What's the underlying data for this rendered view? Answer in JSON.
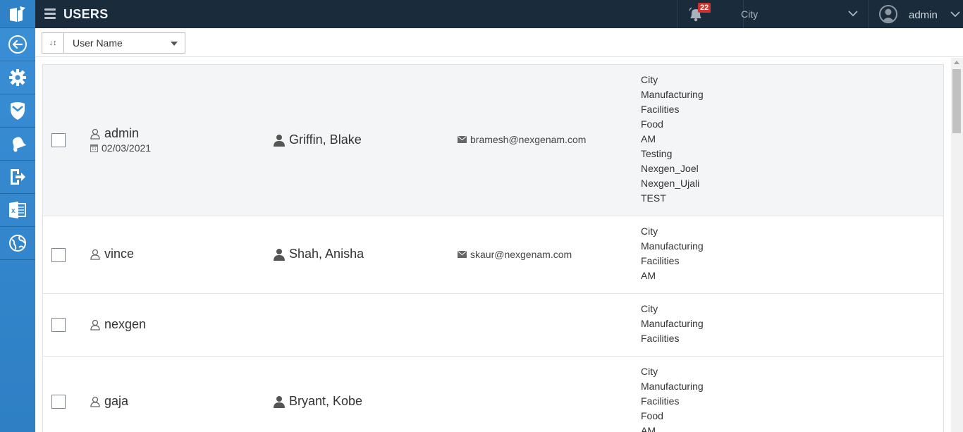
{
  "header": {
    "title": "USERS",
    "notification_count": "22",
    "location_select": "City",
    "user": "admin"
  },
  "sidebar": {
    "items": [
      {
        "icon": "app-logo-icon"
      },
      {
        "icon": "back-arrow-icon"
      },
      {
        "icon": "gear-icon"
      },
      {
        "icon": "shield-icon"
      },
      {
        "icon": "bell-icon"
      },
      {
        "icon": "logout-door-icon"
      },
      {
        "icon": "excel-icon"
      },
      {
        "icon": "globe-icon"
      }
    ]
  },
  "toolbar": {
    "sort_toggle": "↓↕",
    "sort_field": "User Name"
  },
  "users": [
    {
      "username": "admin",
      "date": "02/03/2021",
      "full_name": "Griffin, Blake",
      "email": "bramesh@nexgenam.com",
      "groups": [
        "City",
        "Manufacturing",
        "Facilities",
        "Food",
        "AM",
        "Testing",
        "Nexgen_Joel",
        "Nexgen_Ujali",
        "TEST"
      ]
    },
    {
      "username": "vince",
      "date": "",
      "full_name": "Shah, Anisha",
      "email": "skaur@nexgenam.com",
      "groups": [
        "City",
        "Manufacturing",
        "Facilities",
        "AM"
      ]
    },
    {
      "username": "nexgen",
      "date": "",
      "full_name": "",
      "email": "",
      "groups": [
        "City",
        "Manufacturing",
        "Facilities"
      ]
    },
    {
      "username": "gaja",
      "date": "",
      "full_name": "Bryant, Kobe",
      "email": "",
      "groups": [
        "City",
        "Manufacturing",
        "Facilities",
        "Food",
        "AM"
      ]
    }
  ],
  "colors": {
    "topbar": "#1a2c3c",
    "rail": "#3a8fd6",
    "badge": "#d2322d",
    "selected_row": "#f4f5f6"
  }
}
